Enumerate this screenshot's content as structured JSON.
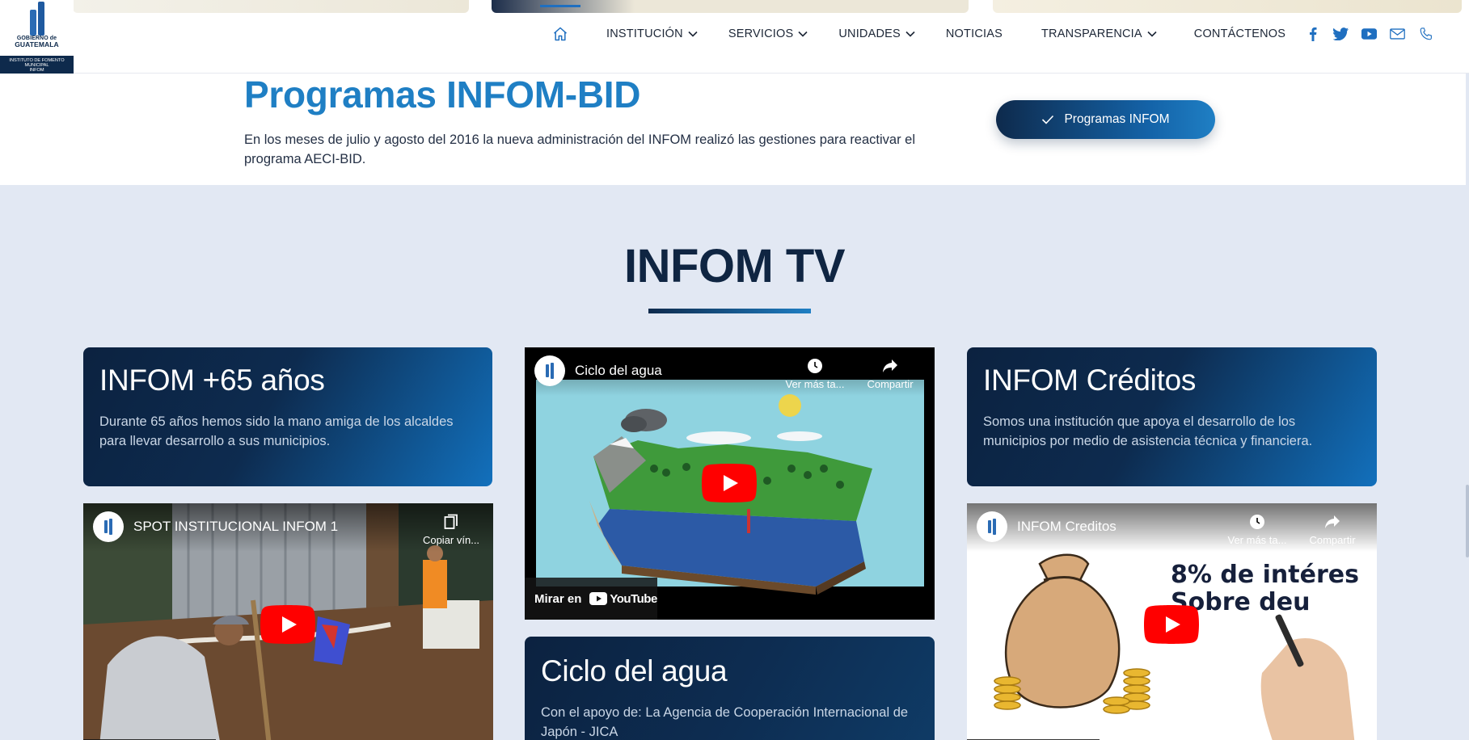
{
  "header": {
    "logo": {
      "line1": "GOBIERNO de",
      "line2": "GUATEMALA",
      "line3": "INSTITUTO DE FOMENTO MUNICIPAL",
      "line4": "INFOM"
    },
    "nav": [
      {
        "label": "INSTITUCIÓN",
        "dropdown": true
      },
      {
        "label": "SERVICIOS",
        "dropdown": true
      },
      {
        "label": "UNIDADES",
        "dropdown": true
      },
      {
        "label": "NOTICIAS",
        "dropdown": false
      },
      {
        "label": "TRANSPARENCIA",
        "dropdown": true
      },
      {
        "label": "CONTÁCTENOS",
        "dropdown": false
      }
    ],
    "social_icons": [
      "facebook-icon",
      "twitter-icon",
      "youtube-icon",
      "mail-icon",
      "phone-icon"
    ],
    "accent_color": "#1f6fc0"
  },
  "intro": {
    "title": "Programas INFOM-BID",
    "text": "En los meses de julio y agosto del 2016 la nueva administración del INFOM realizó las gestiones para reactivar el programa AECI-BID.",
    "button_label": "Programas INFOM"
  },
  "tv": {
    "title": "INFOM TV",
    "cards": [
      {
        "title": "INFOM +65 años",
        "text": "Durante 65 años hemos sido la mano amiga de los alcaldes para llevar desarrollo a sus municipios."
      },
      {
        "title": "INFOM Créditos",
        "text": "Somos una institución que apoya el desarrollo de los municipios por medio de asistencia técnica y financiera."
      },
      {
        "title": "Ciclo del agua",
        "text": "Con el apoyo de: La Agencia de Cooperación Internacional de Japón - JICA"
      }
    ],
    "videos": [
      {
        "title": "SPOT INSTITUCIONAL INFOM 1",
        "action": "Copiar vín..."
      },
      {
        "title": "Ciclo del agua",
        "watch_later": "Ver más ta...",
        "share": "Compartir",
        "watch_on": "Mirar en",
        "youtube": "YouTube"
      },
      {
        "title": "INFOM Creditos",
        "watch_later": "Ver más ta...",
        "share": "Compartir",
        "overlay_line1": "8% de intéres",
        "overlay_line2": "Sobre deu"
      }
    ]
  }
}
